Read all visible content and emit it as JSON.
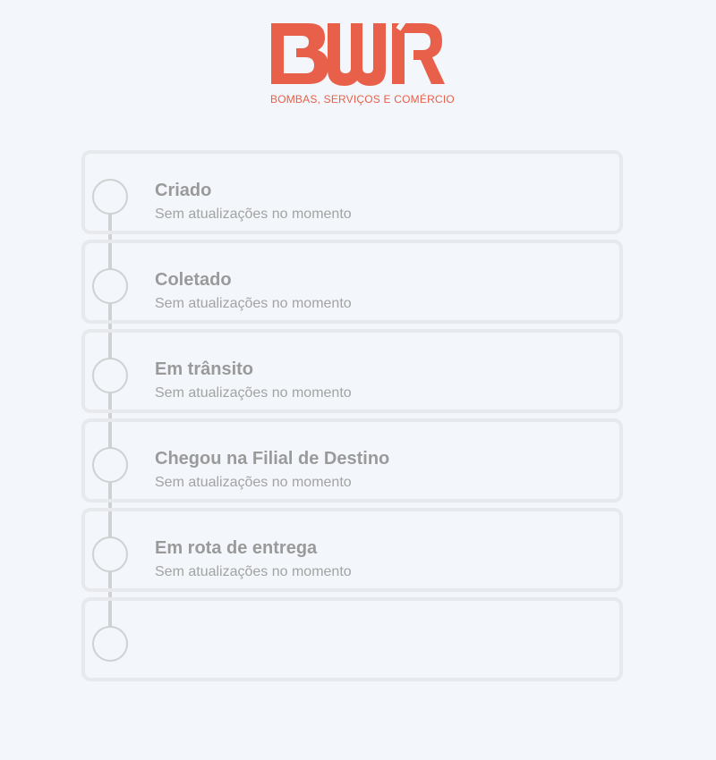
{
  "header": {
    "logo_text": "BWR",
    "tagline": "BOMBAS, SERVIÇOS E COMÉRCIO",
    "brand_color": "#e8604a"
  },
  "timeline": {
    "line_color": "#cfd1d3",
    "steps": [
      {
        "title": "Criado",
        "subtitle": "Sem atualizações no momento"
      },
      {
        "title": "Coletado",
        "subtitle": "Sem atualizações no momento"
      },
      {
        "title": "Em trânsito",
        "subtitle": "Sem atualizações no momento"
      },
      {
        "title": "Chegou na Filial de Destino",
        "subtitle": "Sem atualizações no momento"
      },
      {
        "title": "Em rota de entrega",
        "subtitle": "Sem atualizações no momento"
      },
      {
        "title": "",
        "subtitle": ""
      }
    ]
  }
}
